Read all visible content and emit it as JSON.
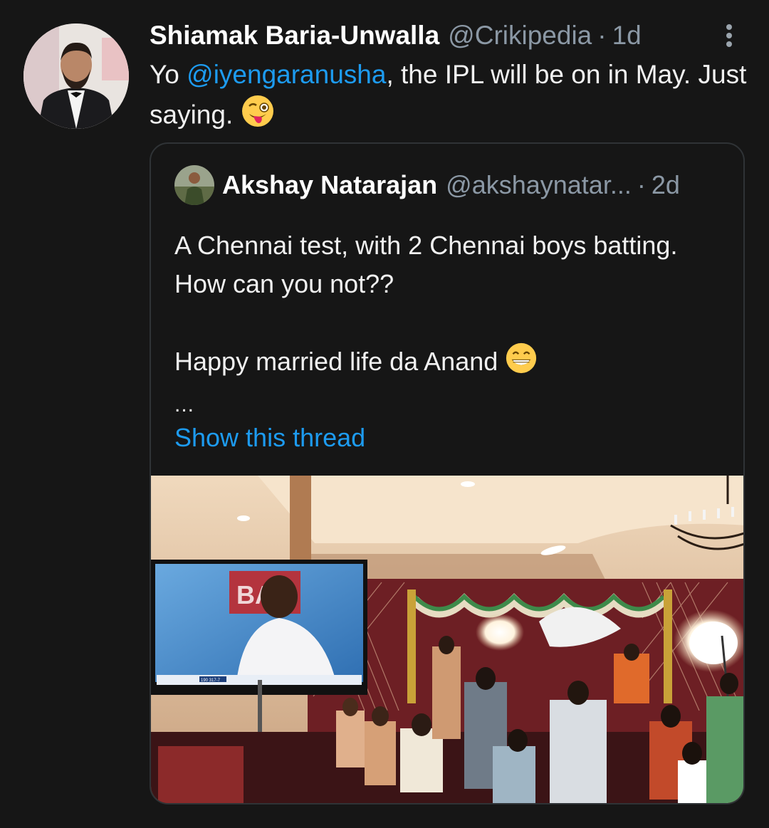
{
  "tweet": {
    "display_name": "Shiamak Baria-Unwalla",
    "handle": "@Crikipedia",
    "separator": "·",
    "time": "1d",
    "text_prefix": "Yo ",
    "mention": "@iyengaranusha",
    "text_suffix": ", the IPL will be on in May. Just saying.",
    "emoji": "winking-face-with-tongue"
  },
  "quote": {
    "display_name": "Akshay Natarajan",
    "handle": "@akshaynatar...",
    "separator": "·",
    "time": "2d",
    "line1": "A Chennai test, with 2 Chennai boys batting. How can you not??",
    "line2": "Happy married life da Anand",
    "line2_emoji": "grinning-face-with-teeth",
    "ellipsis": "...",
    "show_thread": "Show this thread",
    "media": {
      "tv_score": "190 317-7",
      "tv_banner_text": "BA"
    }
  },
  "colors": {
    "background": "#161616",
    "link": "#1d9bf0",
    "muted": "#8b98a5",
    "border": "#2f3336"
  }
}
